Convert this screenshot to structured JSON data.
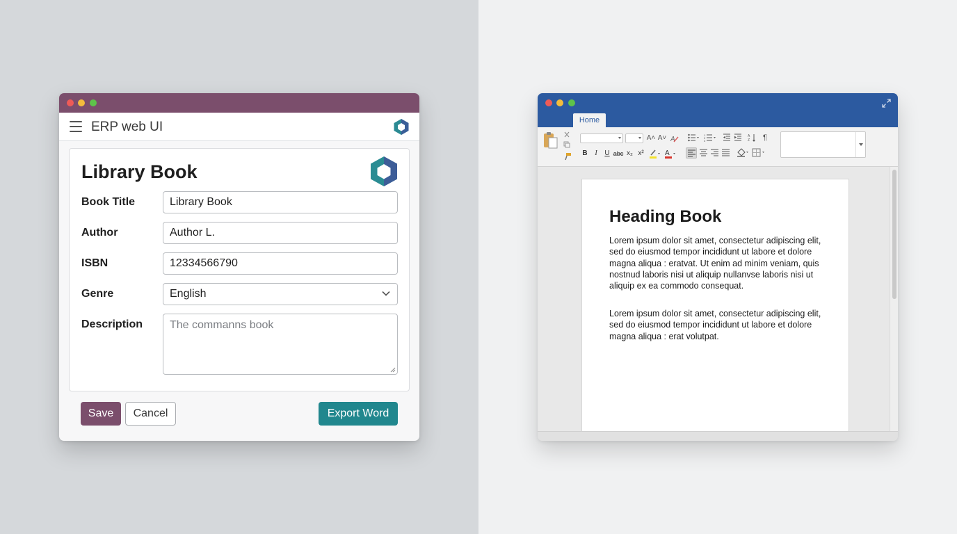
{
  "erp": {
    "app_title": "ERP web UI",
    "form_title": "Library Book",
    "fields": [
      {
        "label": "Book Title",
        "value": "Library Book"
      },
      {
        "label": "Author",
        "value": "Author L."
      },
      {
        "label": "ISBN",
        "value": "12334566790"
      },
      {
        "label": "Genre",
        "value": "English"
      },
      {
        "label": "Description",
        "placeholder": "The commanns book"
      }
    ],
    "buttons": {
      "save": "Save",
      "cancel": "Cancel",
      "export": "Export Word"
    },
    "colors": {
      "brand": "#7b4e6c",
      "export": "#21878e"
    }
  },
  "word": {
    "tab_home": "Home",
    "ribbon": {
      "bold": "B",
      "italic": "I",
      "underline": "U",
      "strike": "abc",
      "subscript": "x₂",
      "superscript": "x²",
      "font_grow": "A˄",
      "font_shrink": "A˅",
      "font_color": "A",
      "pilcrow": "¶"
    },
    "document": {
      "heading": "Heading Book",
      "paragraphs": [
        "Lorem ipsum dolor sit amet, consectetur adipiscing elit, sed do eiusmod tempor incididunt ut labore et dolore magna aliqua : eratvat. Ut enim ad minim veniam, quis nostnud laboris nisi ut aliquip nullanvse laboris nisi ut aliquip ex ea commodo consequat.",
        "Lorem ipsum dolor sit amet, consectetur adipiscing elit, sed do eiusmod tempor incididunt ut labore et dolore magna aliqua : erat volutpat."
      ]
    },
    "colors": {
      "titlebar": "#2c5aa0"
    }
  }
}
